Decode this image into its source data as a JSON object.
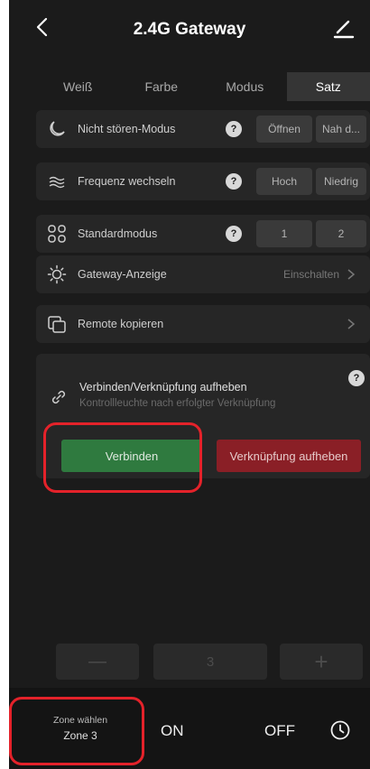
{
  "header": {
    "title": "2.4G Gateway"
  },
  "tabs": [
    {
      "label": "Weiß",
      "active": false
    },
    {
      "label": "Farbe",
      "active": false
    },
    {
      "label": "Modus",
      "active": false
    },
    {
      "label": "Satz",
      "active": true
    }
  ],
  "settings": {
    "dnd": {
      "label": "Nicht stören-Modus",
      "help": "?",
      "options": [
        "Öffnen",
        "Nah d..."
      ]
    },
    "freq": {
      "label": "Frequenz wechseln",
      "help": "?",
      "options": [
        "Hoch",
        "Niedrig"
      ]
    },
    "std": {
      "label": "Standardmodus",
      "help": "?",
      "options": [
        "1",
        "2"
      ]
    },
    "indicator": {
      "label": "Gateway-Anzeige",
      "value": "Einschalten"
    },
    "remote": {
      "label": "Remote kopieren"
    }
  },
  "connect_card": {
    "title": "Verbinden/Verknüpfung aufheben",
    "subtitle": "Kontrollleuchte nach erfolgter Verknüpfung",
    "help": "?",
    "connect_label": "Verbinden",
    "unlink_label": "Verknüpfung aufheben"
  },
  "stepper": {
    "minus": "—",
    "value": "3",
    "plus": "+"
  },
  "bottom": {
    "zone_caption": "Zone wählen",
    "zone_value": "Zone 3",
    "on_label": "ON",
    "off_label": "OFF"
  },
  "colors": {
    "background": "#1b1b1b",
    "connect": "#2f7a3f",
    "unlink": "#8a1f26",
    "highlight": "#e4222a"
  },
  "icons": [
    "back-arrow-icon",
    "edit-pen-icon",
    "moon-icon",
    "wave-icon",
    "grid-icon",
    "sun-icon",
    "remote-copy-icon",
    "link-icon",
    "chevron-right-icon",
    "clock-icon"
  ]
}
